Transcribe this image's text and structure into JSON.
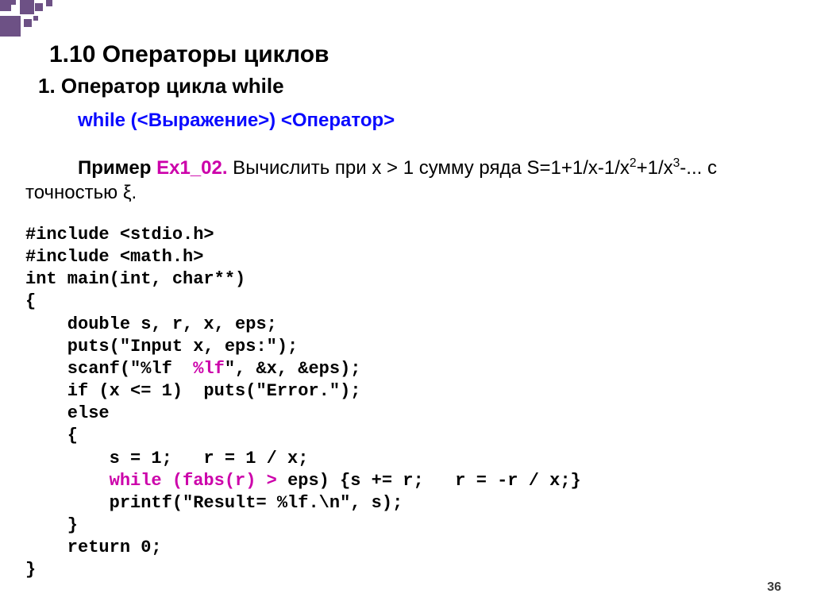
{
  "heading": "1.10 Операторы циклов",
  "subheading": "1. Оператор цикла while",
  "syntax": "while (<Выражение>) <Оператор>",
  "paragraph": {
    "prefix": "Пример ",
    "ex_label": "Ex1_02.",
    "body1": " Вычислить при x > 1 сумму ряда S=1+1/x-1/x",
    "sup2": "2",
    "body2": "+1/x",
    "sup3": "3",
    "body3": "-... с точностью ξ."
  },
  "code": {
    "l01": "#include <stdio.h>",
    "l02": "#include <math.h>",
    "l03": "int main(int, char**)",
    "l04": "{",
    "l05": "    double s, r, x, eps;",
    "l06": "    puts(\"Input x, eps:\");",
    "l07a": "    scanf(\"%lf  ",
    "l07b": "%lf",
    "l07c": "\", &x, &eps);",
    "l08": "    if (x <= 1)  puts(\"Error.\");",
    "l09": "    else",
    "l10": "    {",
    "l11": "        s = 1;   r = 1 / x;",
    "l12a": "        while (fabs(r) > ",
    "l12b": "eps) {s += r;   r = -r / x;}",
    "l13": "        printf(\"Result= %lf.\\n\", s);",
    "l14": "    }",
    "l15": "    return 0;",
    "l16": "}"
  },
  "page_number": "36"
}
